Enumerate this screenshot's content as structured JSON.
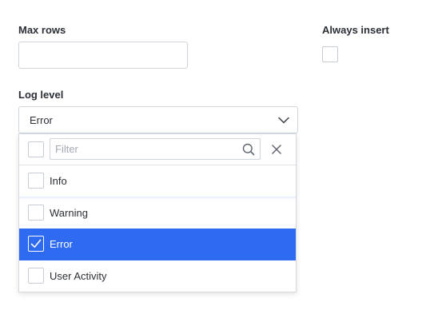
{
  "max_rows": {
    "label": "Max rows",
    "value": "",
    "placeholder": ""
  },
  "always_insert": {
    "label": "Always insert",
    "checked": false
  },
  "log_level": {
    "label": "Log level",
    "selected_value": "Error",
    "dropdown": {
      "filter_placeholder": "Filter",
      "filter_value": "",
      "options": [
        {
          "label": "Info",
          "checked": false
        },
        {
          "label": "Warning",
          "checked": false
        },
        {
          "label": "Error",
          "checked": true
        },
        {
          "label": "User Activity",
          "checked": false
        }
      ]
    }
  },
  "icons": {
    "select_toggle": "chevron-down-icon",
    "filter_search": "search-icon",
    "filter_clear": "close-icon",
    "checked": "checkmark-icon"
  },
  "colors": {
    "selected_option_bg": "#2f6bf0",
    "selected_option_text": "#ffffff",
    "border": "#cfd5dd",
    "label_text": "#2b2f36"
  }
}
